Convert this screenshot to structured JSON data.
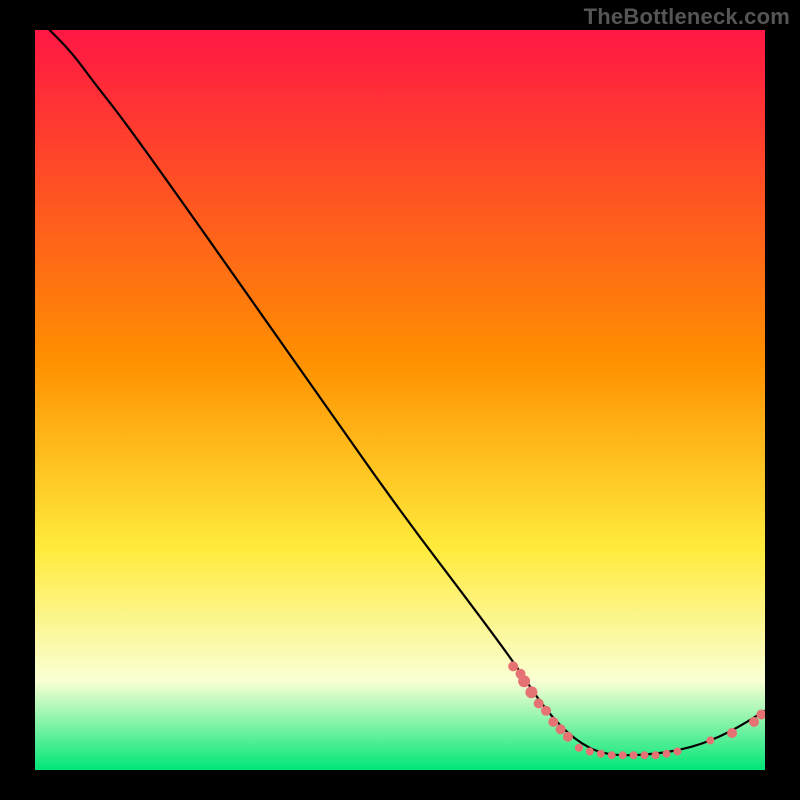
{
  "watermark": "TheBottleneck.com",
  "colors": {
    "top": "#ff1744",
    "mid1": "#ff9100",
    "mid2": "#ffeb3b",
    "mid3": "#faffd5",
    "bottom": "#00e676",
    "curve": "#000000",
    "dot": "#e57373",
    "frame": "#000000"
  },
  "chart_data": {
    "type": "line",
    "title": "",
    "xlabel": "",
    "ylabel": "",
    "xlim": [
      0,
      100
    ],
    "ylim": [
      0,
      100
    ],
    "curve": [
      {
        "x": 2,
        "y": 100
      },
      {
        "x": 5,
        "y": 97
      },
      {
        "x": 8,
        "y": 93
      },
      {
        "x": 12,
        "y": 88
      },
      {
        "x": 20,
        "y": 77
      },
      {
        "x": 30,
        "y": 63
      },
      {
        "x": 40,
        "y": 49
      },
      {
        "x": 50,
        "y": 35
      },
      {
        "x": 60,
        "y": 22
      },
      {
        "x": 66,
        "y": 14
      },
      {
        "x": 70,
        "y": 8
      },
      {
        "x": 74,
        "y": 4
      },
      {
        "x": 78,
        "y": 2
      },
      {
        "x": 84,
        "y": 2
      },
      {
        "x": 90,
        "y": 3
      },
      {
        "x": 95,
        "y": 5
      },
      {
        "x": 100,
        "y": 8
      }
    ],
    "dots": [
      {
        "x": 65.5,
        "y": 14.0,
        "r": 5
      },
      {
        "x": 66.5,
        "y": 13.0,
        "r": 5
      },
      {
        "x": 67.0,
        "y": 12.0,
        "r": 6
      },
      {
        "x": 68.0,
        "y": 10.5,
        "r": 6
      },
      {
        "x": 69.0,
        "y": 9.0,
        "r": 5
      },
      {
        "x": 70.0,
        "y": 8.0,
        "r": 5
      },
      {
        "x": 71.0,
        "y": 6.5,
        "r": 5
      },
      {
        "x": 72.0,
        "y": 5.5,
        "r": 5
      },
      {
        "x": 73.0,
        "y": 4.5,
        "r": 5
      },
      {
        "x": 74.5,
        "y": 3.0,
        "r": 4
      },
      {
        "x": 76.0,
        "y": 2.5,
        "r": 4
      },
      {
        "x": 77.5,
        "y": 2.2,
        "r": 4
      },
      {
        "x": 79.0,
        "y": 2.0,
        "r": 4
      },
      {
        "x": 80.5,
        "y": 2.0,
        "r": 4
      },
      {
        "x": 82.0,
        "y": 2.0,
        "r": 4
      },
      {
        "x": 83.5,
        "y": 2.0,
        "r": 4
      },
      {
        "x": 85.0,
        "y": 2.0,
        "r": 4
      },
      {
        "x": 86.5,
        "y": 2.2,
        "r": 4
      },
      {
        "x": 88.0,
        "y": 2.5,
        "r": 4
      },
      {
        "x": 92.5,
        "y": 4.0,
        "r": 4
      },
      {
        "x": 95.5,
        "y": 5.0,
        "r": 5
      },
      {
        "x": 98.5,
        "y": 6.5,
        "r": 5
      },
      {
        "x": 99.5,
        "y": 7.5,
        "r": 5
      }
    ]
  }
}
